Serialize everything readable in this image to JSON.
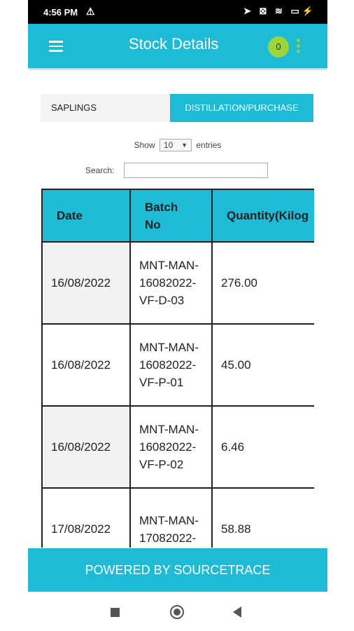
{
  "status_bar": {
    "time": "4:56 PM",
    "warning": "⚠",
    "icons": "➤ ⊠ ≋ ▭⚡"
  },
  "app_bar": {
    "title": "Stock Details",
    "badge_count": "0"
  },
  "tabs": [
    {
      "label": "SAPLINGS"
    },
    {
      "label": "DISTILLATION/PURCHASE"
    }
  ],
  "controls": {
    "show_label": "Show",
    "entries_value": "10",
    "entries_label": "entries",
    "search_label": "Search:",
    "search_value": ""
  },
  "table": {
    "headers": [
      "Date",
      "Batch No",
      "Quantity(Kilog"
    ],
    "rows": [
      {
        "date": "16/08/2022",
        "batch": "MNT-MAN-16082022-VF-D-03",
        "qty": "276.00"
      },
      {
        "date": "16/08/2022",
        "batch": "MNT-MAN-16082022-VF-P-01",
        "qty": "45.00"
      },
      {
        "date": "16/08/2022",
        "batch": "MNT-MAN-16082022-VF-P-02",
        "qty": "6.46"
      },
      {
        "date": "17/08/2022",
        "batch": "MNT-MAN-17082022-",
        "qty": "58.88"
      }
    ]
  },
  "footer": {
    "text": "POWERED BY SOURCETRACE"
  },
  "colors": {
    "primary": "#1ebbd7",
    "badge": "#9bd43b"
  }
}
